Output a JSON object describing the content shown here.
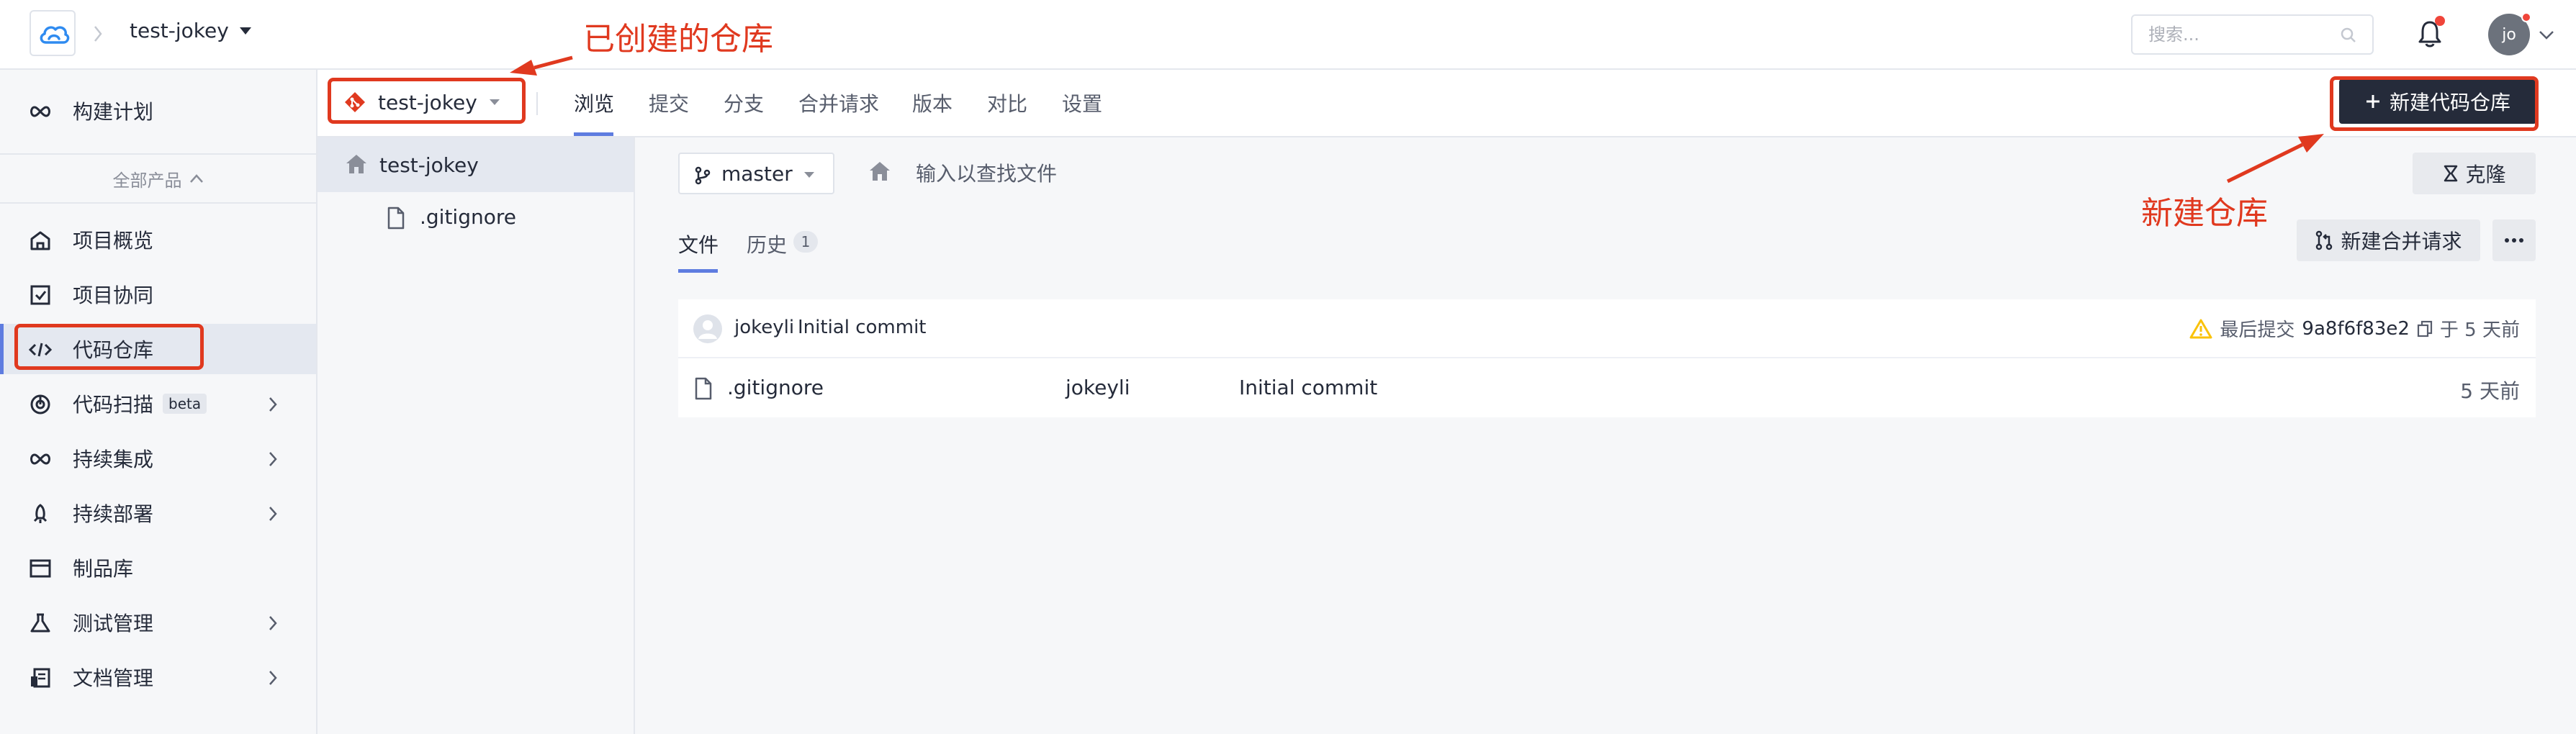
{
  "header": {
    "project_name": "test-jokey",
    "search_placeholder": "搜索...",
    "avatar_initials": "jo"
  },
  "sidebar": {
    "top_item": "构建计划",
    "all_products": "全部产品",
    "items": [
      {
        "label": "项目概览",
        "icon": "home-outline-icon"
      },
      {
        "label": "项目协同",
        "icon": "checkbox-icon"
      },
      {
        "label": "代码仓库",
        "icon": "code-icon"
      },
      {
        "label": "代码扫描",
        "icon": "scan-icon",
        "badge": "beta"
      },
      {
        "label": "持续集成",
        "icon": "infinity-icon"
      },
      {
        "label": "持续部署",
        "icon": "rocket-icon"
      },
      {
        "label": "制品库",
        "icon": "package-icon"
      },
      {
        "label": "测试管理",
        "icon": "flask-icon"
      },
      {
        "label": "文档管理",
        "icon": "document-icon"
      }
    ]
  },
  "repo_bar": {
    "repo_name": "test-jokey",
    "tabs": [
      "浏览",
      "提交",
      "分支",
      "合并请求",
      "版本",
      "对比",
      "设置"
    ],
    "new_repo_label": "新建代码仓库"
  },
  "tree": {
    "root": "test-jokey",
    "files": [
      ".gitignore"
    ]
  },
  "main": {
    "branch": "master",
    "path_placeholder": "输入以查找文件",
    "clone_label": "克隆",
    "sub_tabs": [
      "文件",
      "历史"
    ],
    "history_count": "1",
    "merge_request_label": "新建合并请求",
    "commit": {
      "author": "jokeyli",
      "message": "Initial commit",
      "last_commit_label": "最后提交",
      "hash": "9a8f6f83e2",
      "time": "于 5 天前"
    },
    "files": [
      {
        "name": ".gitignore",
        "author": "jokeyli",
        "message": "Initial commit",
        "time": "5 天前"
      }
    ]
  },
  "annotations": {
    "created_repo": "已创建的仓库",
    "new_repo": "新建仓库"
  },
  "colors": {
    "accent": "#5e7ce0",
    "annotation": "#e0391f",
    "primary_button": "#252b3a",
    "alert_dot": "#f0453a",
    "warning": "#fac20a"
  }
}
